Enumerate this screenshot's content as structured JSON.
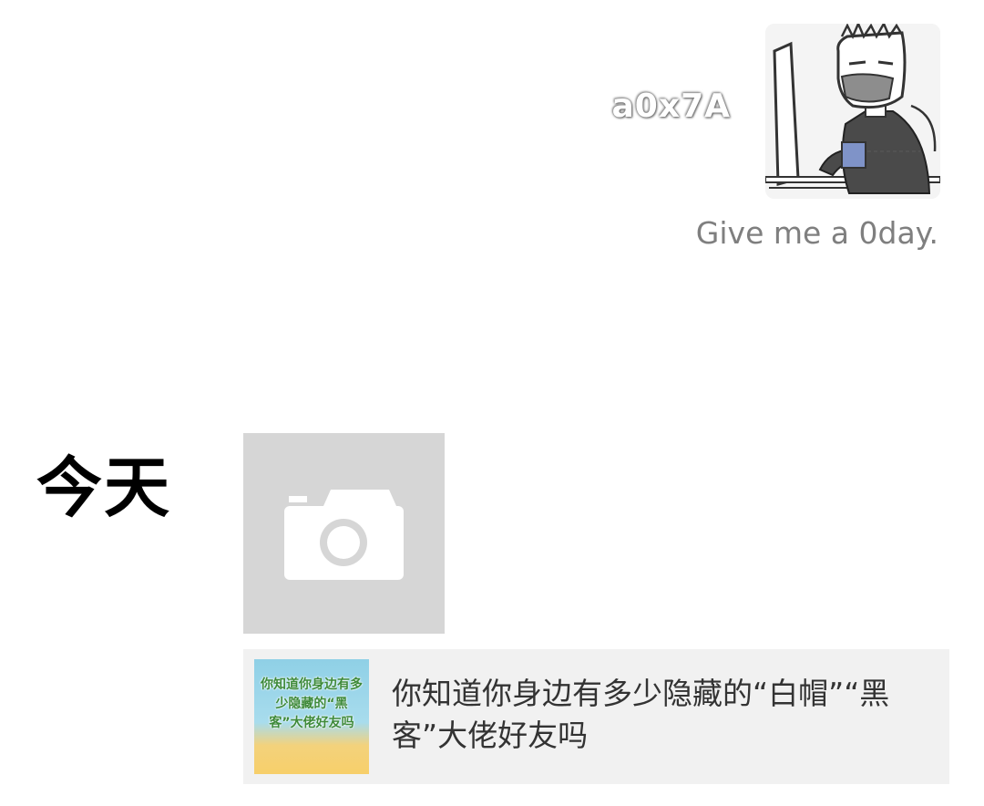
{
  "profile": {
    "username": "a0x7A",
    "signature": "Give me a 0day.",
    "avatar_icon": "avatar-cartoon-hacker"
  },
  "feed": {
    "date_label": "今天",
    "camera_icon": "camera-icon",
    "shared_link": {
      "title": "你知道你身边有多少隐藏的“白帽”“黑客”大佬好友吗",
      "thumbnail_text": "你知道你身边有多少隐藏的“黑客”大佬好友吗"
    }
  },
  "colors": {
    "background": "#ffffff",
    "signature_text": "#7f7f7f",
    "tile_gray": "#d6d6d6",
    "link_background": "#f1f1f1",
    "thumbnail_text": "#3e8a3a"
  }
}
